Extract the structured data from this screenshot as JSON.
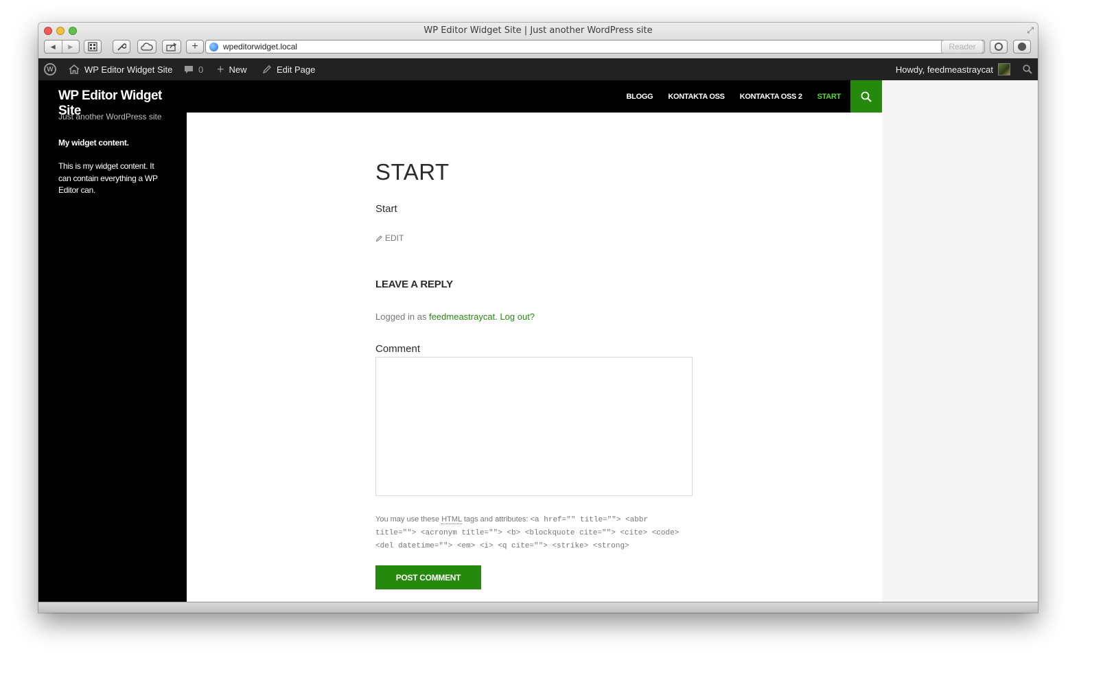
{
  "browser": {
    "window_title": "WP Editor Widget Site | Just another WordPress site",
    "url": "wpeditorwidget.local",
    "reader_label": "Reader",
    "back_glyph": "◀",
    "forward_glyph": "▶",
    "add_glyph": "+",
    "reload_glyph": "⟳",
    "fullscreen_glyph": "⤢"
  },
  "admin_bar": {
    "site_name": "WP Editor Widget Site",
    "comments_count": "0",
    "new_label": "New",
    "edit_page_label": "Edit Page",
    "howdy": "Howdy, feedmeastraycat"
  },
  "site": {
    "title": "WP Editor Widget Site",
    "description": "Just another WordPress site"
  },
  "widget": {
    "title": "My widget content.",
    "body": "This is my widget content. It can contain everything a WP Editor can."
  },
  "nav": {
    "items": [
      "BLOGG",
      "KONTAKTA OSS",
      "KONTAKTA OSS 2",
      "START"
    ],
    "active_index": 3
  },
  "entry": {
    "title": "START",
    "body": "Start",
    "edit_label": "EDIT"
  },
  "comments": {
    "reply_title": "LEAVE A REPLY",
    "logged_in_prefix": "Logged in as ",
    "username": "feedmeastraycat",
    "logout_label": "Log out?",
    "comment_label": "Comment",
    "comment_value": "",
    "allowed_prefix": "You may use these ",
    "allowed_abbr": "HTML",
    "allowed_mid": " tags and attributes: ",
    "allowed_code": "<a href=\"\" title=\"\"> <abbr title=\"\"> <acronym title=\"\"> <b> <blockquote cite=\"\"> <cite> <code> <del datetime=\"\"> <em> <i> <q cite=\"\"> <strike> <strong>",
    "submit_label": "POST COMMENT"
  },
  "colors": {
    "accent": "#24890d",
    "active_nav": "#55d737",
    "sidebar_bg": "#000000",
    "admin_bar_bg": "#222222"
  }
}
